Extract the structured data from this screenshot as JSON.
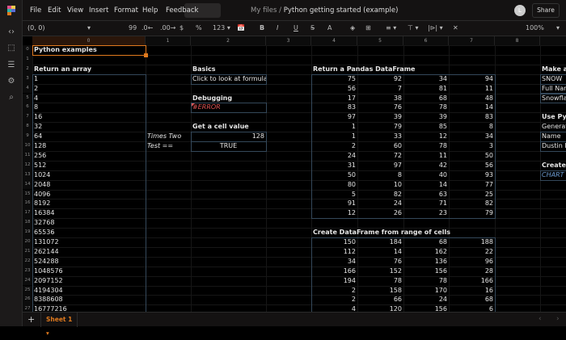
{
  "menu": {
    "items": [
      "File",
      "Edit",
      "View",
      "Insert",
      "Format",
      "Help",
      "Feedback"
    ],
    "breadcrumb_parent": "My files",
    "breadcrumb_sep": "/",
    "file_title": "Python getting started (example)",
    "avatar_initial": "L",
    "share": "Share"
  },
  "toolbar": {
    "cell_ref": "(0, 0)",
    "buttons": [
      "99",
      ".0←",
      ".00→",
      "$",
      "%",
      "123 ▾",
      "📅",
      "B",
      "I",
      "U",
      "S̶",
      "A",
      "◈",
      "⊞",
      "≡ ▾",
      "⊤ ▾",
      "|⊳| ▾",
      "✕"
    ],
    "zoom": "100%"
  },
  "sidebar": {
    "icons": [
      "code-icon",
      "selection-icon",
      "database-icon",
      "settings-icon",
      "search-icon"
    ]
  },
  "columns": [
    "0",
    "1",
    "2",
    "3",
    "4",
    "5",
    "6",
    "7",
    "8"
  ],
  "rows": [
    "0",
    "1",
    "2",
    "3",
    "4",
    "5",
    "6",
    "7",
    "8",
    "9",
    "10",
    "11",
    "12",
    "13",
    "14",
    "15",
    "16",
    "17",
    "18",
    "19",
    "20",
    "21",
    "22",
    "23",
    "24",
    "25",
    "26",
    "27"
  ],
  "sheet": {
    "title": "Python examples",
    "array_heading": "Return an array",
    "array_values": [
      "1",
      "2",
      "4",
      "8",
      "16",
      "32",
      "64",
      "128",
      "256",
      "512",
      "1024",
      "2048",
      "4096",
      "8192",
      "16384",
      "32768",
      "65536",
      "131072",
      "262144",
      "524288",
      "1048576",
      "2097152",
      "4194304",
      "8388608",
      "16777216"
    ],
    "basics_heading": "Basics",
    "basics_cell": "Click to look at formula",
    "debug_heading": "Debugging",
    "debug_cell": "#ERROR",
    "getcell_heading": "Get a cell value",
    "times_two_label": "Times Two",
    "times_two_value": "128",
    "test_label": "Test ==",
    "test_value": "TRUE",
    "pandas_heading": "Return a Pandas DataFrame",
    "pandas_rows": [
      [
        75,
        92,
        34,
        94
      ],
      [
        56,
        7,
        81,
        11
      ],
      [
        17,
        38,
        68,
        48
      ],
      [
        83,
        76,
        78,
        14
      ],
      [
        97,
        39,
        39,
        83
      ],
      [
        1,
        79,
        85,
        8
      ],
      [
        1,
        33,
        12,
        34
      ],
      [
        2,
        60,
        78,
        3
      ],
      [
        24,
        72,
        11,
        50
      ],
      [
        31,
        97,
        42,
        56
      ],
      [
        50,
        8,
        40,
        93
      ],
      [
        80,
        10,
        14,
        77
      ],
      [
        5,
        82,
        63,
        25
      ],
      [
        91,
        24,
        71,
        82
      ],
      [
        12,
        26,
        23,
        79
      ]
    ],
    "range_heading": "Create DataFrame from range of cells",
    "range_rows": [
      [
        150,
        184,
        68,
        188
      ],
      [
        112,
        14,
        162,
        22
      ],
      [
        34,
        76,
        136,
        96
      ],
      [
        166,
        152,
        156,
        28
      ],
      [
        194,
        78,
        78,
        166
      ],
      [
        2,
        158,
        170,
        16
      ],
      [
        2,
        66,
        24,
        68
      ],
      [
        4,
        120,
        156,
        6
      ]
    ],
    "api_heading": "Make ar",
    "api_cells": [
      "SNOW",
      "Full Nam",
      "Snowfla"
    ],
    "usepy_heading": "Use Pyt",
    "usepy_cells": [
      "Generat",
      "Name",
      "Dustin M"
    ],
    "chart_heading": "Create a",
    "chart_cell": "CHART"
  },
  "bottom": {
    "add": "+",
    "sheet_tab": "Sheet 1 ▾",
    "prev": "‹",
    "next": "›"
  },
  "colors": {
    "accent": "#e07a1e",
    "error": "#e05555",
    "chart_text": "#6a9ad0",
    "box_border": "#34485a"
  }
}
